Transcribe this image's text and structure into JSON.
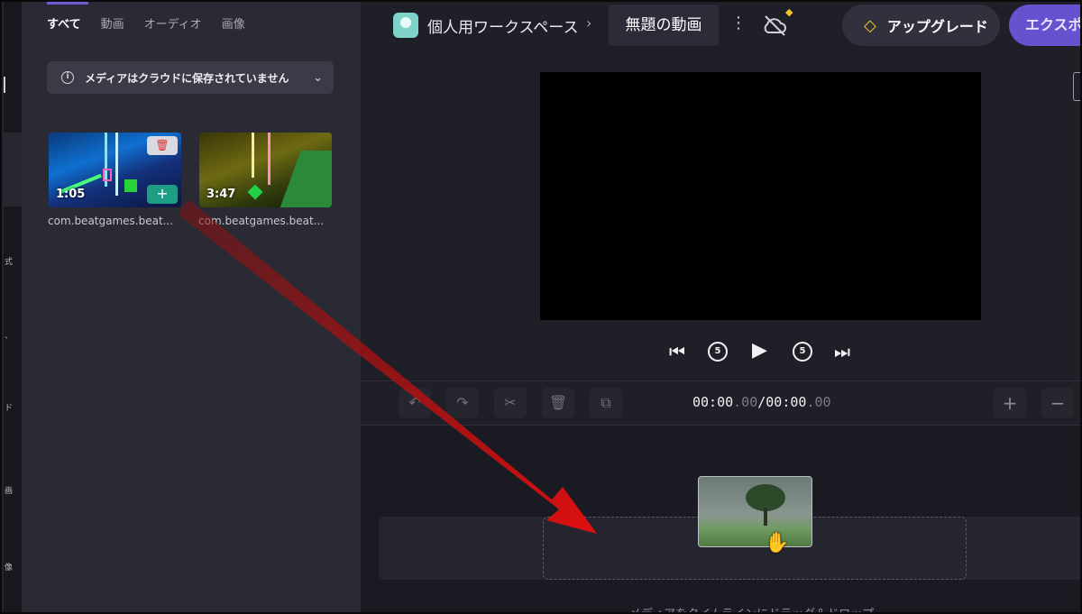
{
  "sidebar_rail": {
    "glyphs": [
      "式",
      "、",
      "ド",
      "画",
      "像"
    ]
  },
  "media_panel": {
    "tabs": [
      {
        "label": "すべて",
        "active": true
      },
      {
        "label": "動画",
        "active": false
      },
      {
        "label": "オーディオ",
        "active": false
      },
      {
        "label": "画像",
        "active": false
      }
    ],
    "notice": {
      "text": "メディアはクラウドに保存されていません",
      "icon": "info-icon"
    },
    "items": [
      {
        "duration": "1:05",
        "name": "com.beatgames.beat..."
      },
      {
        "duration": "3:47",
        "name": "com.beatgames.beat..."
      }
    ]
  },
  "header": {
    "workspace": "個人用ワークスペース",
    "project_title": "無題の動画",
    "upgrade_label": "アップグレード",
    "export_label": "エクスポ"
  },
  "transport": {
    "skip_back_seconds": "5",
    "skip_forward_seconds": "5"
  },
  "timeline": {
    "time_current_main": "00:00",
    "time_current_frac": ".00",
    "time_separator": "/",
    "time_total_main": "00:00",
    "time_total_frac": ".00",
    "drop_hint": "メディアをタイムラインにドラッグ＆ドロップ"
  },
  "colors": {
    "accent": "#6651cf",
    "arrow": "#d01010",
    "add_button": "#1f9d84",
    "premium_gem": "#f3c22a"
  }
}
